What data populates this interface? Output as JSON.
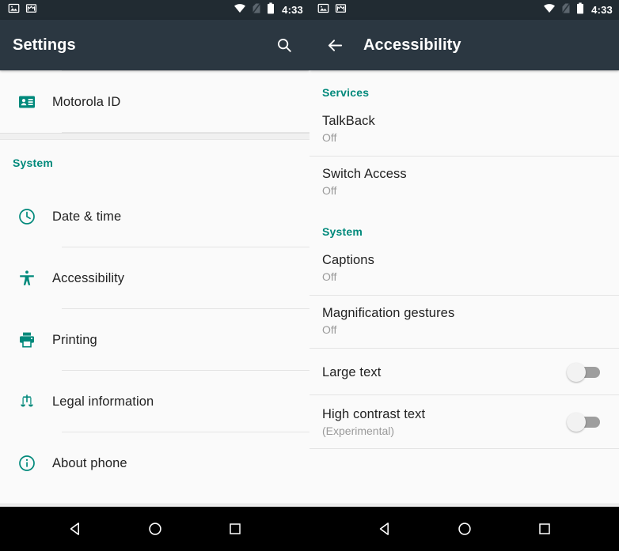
{
  "status_bar": {
    "time": "4:33",
    "left_icons": [
      "photo-icon",
      "gmail-icon"
    ],
    "right_icons": [
      "wifi-icon",
      "no-sim-icon",
      "battery-icon"
    ]
  },
  "colors": {
    "toolbar_bg": "#2b3741",
    "statusbar_bg": "#212b32",
    "accent_teal": "#00897b",
    "content_bg": "#fafafa",
    "divider": "#e4e4e4",
    "secondary_text": "#9a9a9a",
    "primary_text": "#222222",
    "navbar_bg": "#000000"
  },
  "left_screen": {
    "toolbar": {
      "title": "Settings",
      "search_icon": "search-icon"
    },
    "items": [
      {
        "label": "Motorola ID",
        "icon": "id-card-icon"
      }
    ],
    "system_section": {
      "header": "System",
      "items": [
        {
          "label": "Date & time",
          "icon": "clock-icon"
        },
        {
          "label": "Accessibility",
          "icon": "accessibility-person-icon"
        },
        {
          "label": "Printing",
          "icon": "printer-icon"
        },
        {
          "label": "Legal information",
          "icon": "scales-icon"
        },
        {
          "label": "About phone",
          "icon": "info-circle-icon"
        }
      ]
    }
  },
  "right_screen": {
    "toolbar": {
      "back_icon": "arrow-back-icon",
      "title": "Accessibility"
    },
    "sections": [
      {
        "header": "Services",
        "items": [
          {
            "title": "TalkBack",
            "subtitle": "Off",
            "type": "text"
          },
          {
            "title": "Switch Access",
            "subtitle": "Off",
            "type": "text"
          }
        ]
      },
      {
        "header": "System",
        "items": [
          {
            "title": "Captions",
            "subtitle": "Off",
            "type": "text"
          },
          {
            "title": "Magnification gestures",
            "subtitle": "Off",
            "type": "text"
          },
          {
            "title": "Large text",
            "subtitle": "",
            "type": "toggle",
            "toggle_state": "off"
          },
          {
            "title": "High contrast text",
            "subtitle": "(Experimental)",
            "type": "toggle",
            "toggle_state": "off"
          }
        ]
      }
    ]
  },
  "nav_bar": {
    "buttons": [
      {
        "name": "back-nav-button",
        "icon": "triangle-back-icon"
      },
      {
        "name": "home-nav-button",
        "icon": "circle-home-icon"
      },
      {
        "name": "recents-nav-button",
        "icon": "square-recents-icon"
      }
    ]
  }
}
